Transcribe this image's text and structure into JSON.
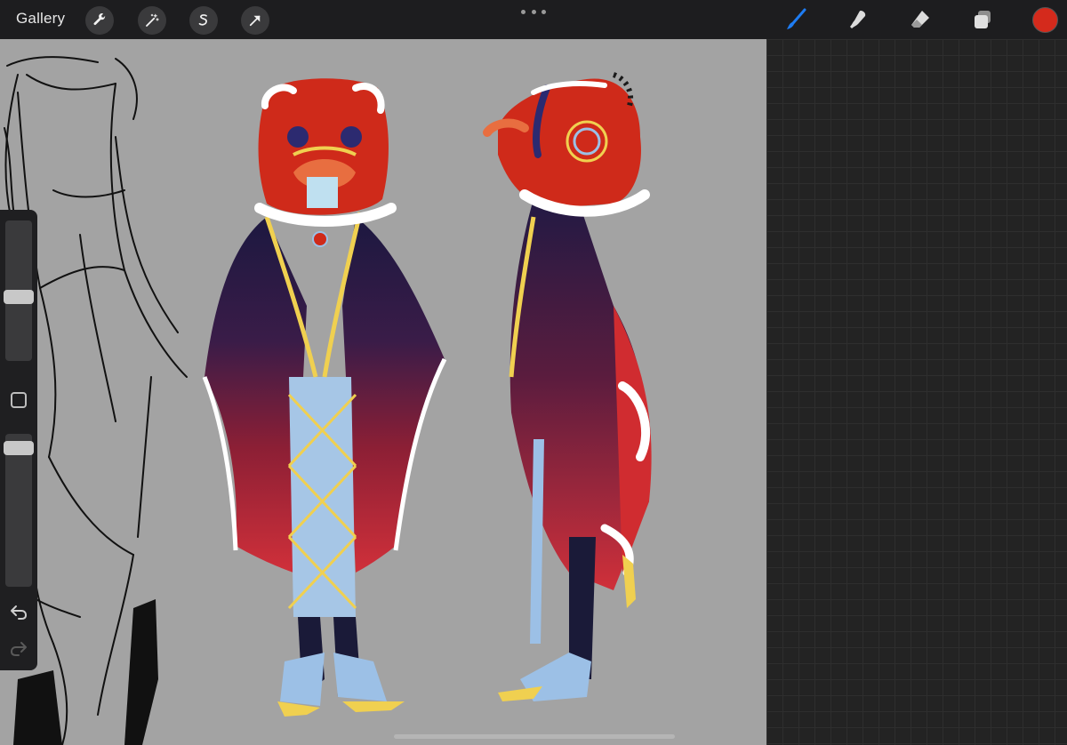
{
  "topbar": {
    "gallery_label": "Gallery",
    "tools": [
      "wrench-icon",
      "magic-wand-icon",
      "selection-icon",
      "transform-arrow-icon"
    ],
    "right_tools": [
      "brush-icon",
      "smudge-icon",
      "eraser-icon",
      "layers-icon"
    ],
    "current_color": "#d42a1c",
    "brush_active_color": "#1e7cf2"
  },
  "sidebar": {
    "brush_size_level": 0.45,
    "opacity_level": 0.05
  },
  "canvas": {
    "background": "#a3a3a3"
  }
}
